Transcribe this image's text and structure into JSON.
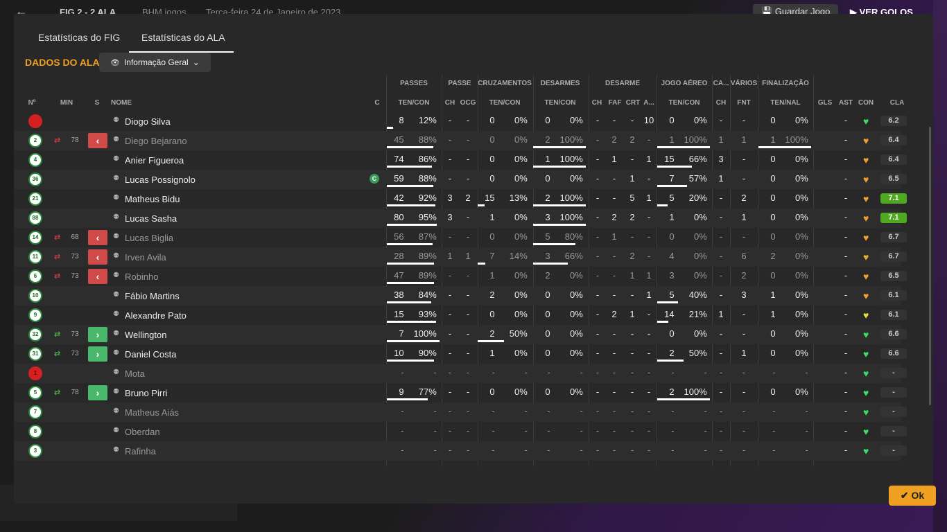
{
  "topbar": {
    "back_icon": "arrow-left-icon",
    "score": "FIG  2 - 2  ALA",
    "meta": "BHM jogos",
    "date": "Terça-feira 24 de Janeiro de 2023",
    "save_label": "Guardar Jogo",
    "goals_label": "VER GOLOS"
  },
  "tabs": [
    {
      "label": "Estatísticas do FIG",
      "active": false
    },
    {
      "label": "Estatísticas do ALA",
      "active": true
    }
  ],
  "section_title": "DADOS DO ALA",
  "dropdown": {
    "label": "Informação Geral",
    "icon": "eye-icon"
  },
  "group_headers": {
    "passes": "PASSES",
    "passe": "PASSE",
    "cruzamentos": "CRUZAMENTOS",
    "desarmes": "DESARMES",
    "desarme": "DESARME",
    "jogo_aereo": "JOGO AÉREO",
    "ca": "CA...",
    "varios": "VÁRIOS",
    "finalizacao": "FINALIZAÇÃO"
  },
  "columns": {
    "no": "Nº",
    "min": "MIN",
    "s": "S",
    "nome": "NOME",
    "c": "C",
    "passes_tc": "TEN/CON",
    "passe_ch": "CH",
    "passe_ocg": "OCG",
    "cruz_tc": "TEN/CON",
    "des_tc": "TEN/CON",
    "desarme_ch": "CH",
    "desarme_faf": "FAF",
    "desarme_crt": "CRT",
    "desarme_a": "A...",
    "aereo_tc": "TEN/CON",
    "ca_ch": "CH",
    "varios_fnt": "FNT",
    "fin_tn": "TEN/NAL",
    "gls": "GLS",
    "ast": "AST",
    "con": "CON",
    "cla": "CLA"
  },
  "rows": [
    {
      "num": "",
      "gk": true,
      "sub": "",
      "min": "",
      "name": "Diogo Silva",
      "cap": false,
      "dim": false,
      "p": [
        "8",
        "12%"
      ],
      "pc": [
        "-",
        "-"
      ],
      "cz": [
        "0",
        "0%"
      ],
      "ds": [
        "0",
        "0%"
      ],
      "de": [
        "-",
        "-",
        "-",
        "10"
      ],
      "ae": [
        "0",
        "0%"
      ],
      "ca": "-",
      "fnt": "-",
      "fn": [
        "0",
        "0%"
      ],
      "gls": "",
      "ast": "-",
      "con": "#3ddc6a",
      "cla": "6.2",
      "hi": false,
      "bars": {
        "p": 0.12,
        "cz": 0,
        "ds": 0,
        "ae": 0,
        "fn": 0
      }
    },
    {
      "num": "2",
      "gk": false,
      "sub": "out",
      "min": "78",
      "name": "Diego Bejarano",
      "cap": false,
      "dim": true,
      "p": [
        "45",
        "88%"
      ],
      "pc": [
        "-",
        "-"
      ],
      "cz": [
        "0",
        "0%"
      ],
      "ds": [
        "2",
        "100%"
      ],
      "de": [
        "-",
        "2",
        "2",
        "-"
      ],
      "ae": [
        "1",
        "100%"
      ],
      "ca": "1",
      "fnt": "1",
      "fn": [
        "1",
        "100%"
      ],
      "gls": "",
      "ast": "-",
      "con": "#f0a030",
      "cla": "6.4",
      "hi": false,
      "bars": {
        "p": 0.88,
        "cz": 0,
        "ds": 1,
        "ae": 1,
        "fn": 1
      }
    },
    {
      "num": "4",
      "gk": false,
      "sub": "",
      "min": "",
      "name": "Anier Figueroa",
      "cap": false,
      "dim": false,
      "p": [
        "74",
        "86%"
      ],
      "pc": [
        "-",
        "-"
      ],
      "cz": [
        "0",
        "0%"
      ],
      "ds": [
        "1",
        "100%"
      ],
      "de": [
        "-",
        "1",
        "-",
        "1"
      ],
      "ae": [
        "15",
        "66%"
      ],
      "ca": "3",
      "fnt": "-",
      "fn": [
        "0",
        "0%"
      ],
      "gls": "",
      "ast": "-",
      "con": "#f0a030",
      "cla": "6.4",
      "hi": false,
      "bars": {
        "p": 0.86,
        "cz": 0,
        "ds": 1,
        "ae": 0.66,
        "fn": 0
      }
    },
    {
      "num": "36",
      "gk": false,
      "sub": "",
      "min": "",
      "name": "Lucas Possignolo",
      "cap": true,
      "dim": false,
      "p": [
        "59",
        "88%"
      ],
      "pc": [
        "-",
        "-"
      ],
      "cz": [
        "0",
        "0%"
      ],
      "ds": [
        "0",
        "0%"
      ],
      "de": [
        "-",
        "-",
        "1",
        "-"
      ],
      "ae": [
        "7",
        "57%"
      ],
      "ca": "1",
      "fnt": "-",
      "fn": [
        "0",
        "0%"
      ],
      "gls": "",
      "ast": "-",
      "con": "#f0a030",
      "cla": "6.5",
      "hi": false,
      "bars": {
        "p": 0.88,
        "cz": 0,
        "ds": 0,
        "ae": 0.57,
        "fn": 0
      }
    },
    {
      "num": "21",
      "gk": false,
      "sub": "",
      "min": "",
      "name": "Matheus Bidu",
      "cap": false,
      "dim": false,
      "p": [
        "42",
        "92%"
      ],
      "pc": [
        "3",
        "2"
      ],
      "cz": [
        "15",
        "13%"
      ],
      "ds": [
        "2",
        "100%"
      ],
      "de": [
        "-",
        "-",
        "5",
        "1"
      ],
      "ae": [
        "5",
        "20%"
      ],
      "ca": "-",
      "fnt": "2",
      "fn": [
        "0",
        "0%"
      ],
      "gls": "",
      "ast": "-",
      "con": "#f0a030",
      "cla": "7.1",
      "hi": true,
      "bars": {
        "p": 0.92,
        "cz": 0.13,
        "ds": 1,
        "ae": 0.2,
        "fn": 0
      }
    },
    {
      "num": "88",
      "gk": false,
      "sub": "",
      "min": "",
      "name": "Lucas Sasha",
      "cap": false,
      "dim": false,
      "p": [
        "80",
        "95%"
      ],
      "pc": [
        "3",
        "-"
      ],
      "cz": [
        "1",
        "0%"
      ],
      "ds": [
        "3",
        "100%"
      ],
      "de": [
        "-",
        "2",
        "2",
        "-"
      ],
      "ae": [
        "1",
        "0%"
      ],
      "ca": "-",
      "fnt": "1",
      "fn": [
        "0",
        "0%"
      ],
      "gls": "",
      "ast": "-",
      "con": "#f0a030",
      "cla": "7.1",
      "hi": true,
      "bars": {
        "p": 0.95,
        "cz": 0,
        "ds": 1,
        "ae": 0,
        "fn": 0
      }
    },
    {
      "num": "14",
      "gk": false,
      "sub": "out",
      "min": "68",
      "name": "Lucas Biglia",
      "cap": false,
      "dim": true,
      "p": [
        "56",
        "87%"
      ],
      "pc": [
        "-",
        "-"
      ],
      "cz": [
        "0",
        "0%"
      ],
      "ds": [
        "5",
        "80%"
      ],
      "de": [
        "-",
        "1",
        "-",
        "-"
      ],
      "ae": [
        "0",
        "0%"
      ],
      "ca": "-",
      "fnt": "-",
      "fn": [
        "0",
        "0%"
      ],
      "gls": "",
      "ast": "-",
      "con": "#f0a030",
      "cla": "6.7",
      "hi": false,
      "bars": {
        "p": 0.87,
        "cz": 0,
        "ds": 0.8,
        "ae": 0,
        "fn": 0
      }
    },
    {
      "num": "11",
      "gk": false,
      "sub": "out",
      "min": "73",
      "name": "Irven Avila",
      "cap": false,
      "dim": true,
      "p": [
        "28",
        "89%"
      ],
      "pc": [
        "1",
        "1"
      ],
      "cz": [
        "7",
        "14%"
      ],
      "ds": [
        "3",
        "66%"
      ],
      "de": [
        "-",
        "-",
        "2",
        "-"
      ],
      "ae": [
        "4",
        "0%"
      ],
      "ca": "-",
      "fnt": "6",
      "fn": [
        "2",
        "0%"
      ],
      "gls": "",
      "ast": "-",
      "con": "#e0b030",
      "cla": "6.7",
      "hi": false,
      "bars": {
        "p": 0.89,
        "cz": 0.14,
        "ds": 0.66,
        "ae": 0,
        "fn": 0
      }
    },
    {
      "num": "6",
      "gk": false,
      "sub": "out",
      "min": "73",
      "name": "Robinho",
      "cap": false,
      "dim": true,
      "p": [
        "47",
        "89%"
      ],
      "pc": [
        "-",
        "-"
      ],
      "cz": [
        "1",
        "0%"
      ],
      "ds": [
        "2",
        "0%"
      ],
      "de": [
        "-",
        "-",
        "1",
        "1"
      ],
      "ae": [
        "3",
        "0%"
      ],
      "ca": "-",
      "fnt": "2",
      "fn": [
        "0",
        "0%"
      ],
      "gls": "",
      "ast": "-",
      "con": "#f0a030",
      "cla": "6.5",
      "hi": false,
      "bars": {
        "p": 0.89,
        "cz": 0,
        "ds": 0,
        "ae": 0,
        "fn": 0
      }
    },
    {
      "num": "10",
      "gk": false,
      "sub": "",
      "min": "",
      "name": "Fábio Martins",
      "cap": false,
      "dim": false,
      "p": [
        "38",
        "84%"
      ],
      "pc": [
        "-",
        "-"
      ],
      "cz": [
        "2",
        "0%"
      ],
      "ds": [
        "0",
        "0%"
      ],
      "de": [
        "-",
        "-",
        "-",
        "1"
      ],
      "ae": [
        "5",
        "40%"
      ],
      "ca": "-",
      "fnt": "3",
      "fn": [
        "1",
        "0%"
      ],
      "gls": "",
      "ast": "-",
      "con": "#f0a030",
      "cla": "6.1",
      "hi": false,
      "bars": {
        "p": 0.84,
        "cz": 0,
        "ds": 0,
        "ae": 0.4,
        "fn": 0
      }
    },
    {
      "num": "9",
      "gk": false,
      "sub": "",
      "min": "",
      "name": "Alexandre Pato",
      "cap": false,
      "dim": false,
      "p": [
        "15",
        "93%"
      ],
      "pc": [
        "-",
        "-"
      ],
      "cz": [
        "0",
        "0%"
      ],
      "ds": [
        "0",
        "0%"
      ],
      "de": [
        "-",
        "2",
        "1",
        "-"
      ],
      "ae": [
        "14",
        "21%"
      ],
      "ca": "1",
      "fnt": "-",
      "fn": [
        "1",
        "0%"
      ],
      "gls": "",
      "ast": "-",
      "con": "#e0e040",
      "cla": "6.1",
      "hi": false,
      "bars": {
        "p": 0.93,
        "cz": 0,
        "ds": 0,
        "ae": 0.21,
        "fn": 0
      }
    },
    {
      "num": "32",
      "gk": false,
      "sub": "in",
      "min": "73",
      "name": "Wellington",
      "cap": false,
      "dim": false,
      "p": [
        "7",
        "100%"
      ],
      "pc": [
        "-",
        "-"
      ],
      "cz": [
        "2",
        "50%"
      ],
      "ds": [
        "0",
        "0%"
      ],
      "de": [
        "-",
        "-",
        "-",
        "-"
      ],
      "ae": [
        "0",
        "0%"
      ],
      "ca": "-",
      "fnt": "-",
      "fn": [
        "0",
        "0%"
      ],
      "gls": "",
      "ast": "-",
      "con": "#3ddc6a",
      "cla": "6.6",
      "hi": false,
      "bars": {
        "p": 1,
        "cz": 0.5,
        "ds": 0,
        "ae": 0,
        "fn": 0
      }
    },
    {
      "num": "31",
      "gk": false,
      "sub": "in",
      "min": "73",
      "name": "Daniel Costa",
      "cap": false,
      "dim": false,
      "p": [
        "10",
        "90%"
      ],
      "pc": [
        "-",
        "-"
      ],
      "cz": [
        "1",
        "0%"
      ],
      "ds": [
        "0",
        "0%"
      ],
      "de": [
        "-",
        "-",
        "-",
        "-"
      ],
      "ae": [
        "2",
        "50%"
      ],
      "ca": "-",
      "fnt": "1",
      "fn": [
        "0",
        "0%"
      ],
      "gls": "",
      "ast": "-",
      "con": "#3ddc6a",
      "cla": "6.6",
      "hi": false,
      "bars": {
        "p": 0.9,
        "cz": 0,
        "ds": 0,
        "ae": 0.5,
        "fn": 0
      }
    },
    {
      "num": "1",
      "gk": true,
      "sub": "",
      "min": "",
      "name": "Mota",
      "cap": false,
      "dim": true,
      "p": [
        "-",
        "-"
      ],
      "pc": [
        "-",
        "-"
      ],
      "cz": [
        "-",
        "-"
      ],
      "ds": [
        "-",
        "-"
      ],
      "de": [
        "-",
        "-",
        "-",
        "-"
      ],
      "ae": [
        "-",
        "-"
      ],
      "ca": "-",
      "fnt": "-",
      "fn": [
        "-",
        "-"
      ],
      "gls": "",
      "ast": "-",
      "con": "#3ddc6a",
      "cla": "-",
      "hi": false,
      "bars": {
        "p": 0,
        "cz": 0,
        "ds": 0,
        "ae": 0,
        "fn": 0
      }
    },
    {
      "num": "5",
      "gk": false,
      "sub": "in",
      "min": "78",
      "name": "Bruno Pirri",
      "cap": false,
      "dim": false,
      "p": [
        "9",
        "77%"
      ],
      "pc": [
        "-",
        "-"
      ],
      "cz": [
        "0",
        "0%"
      ],
      "ds": [
        "0",
        "0%"
      ],
      "de": [
        "-",
        "-",
        "-",
        "-"
      ],
      "ae": [
        "2",
        "100%"
      ],
      "ca": "-",
      "fnt": "-",
      "fn": [
        "0",
        "0%"
      ],
      "gls": "",
      "ast": "-",
      "con": "#3ddc6a",
      "cla": "-",
      "hi": false,
      "bars": {
        "p": 0.77,
        "cz": 0,
        "ds": 0,
        "ae": 1,
        "fn": 0
      }
    },
    {
      "num": "7",
      "gk": false,
      "sub": "",
      "min": "",
      "name": "Matheus Aiás",
      "cap": false,
      "dim": true,
      "p": [
        "-",
        "-"
      ],
      "pc": [
        "-",
        "-"
      ],
      "cz": [
        "-",
        "-"
      ],
      "ds": [
        "-",
        "-"
      ],
      "de": [
        "-",
        "-",
        "-",
        "-"
      ],
      "ae": [
        "-",
        "-"
      ],
      "ca": "-",
      "fnt": "-",
      "fn": [
        "-",
        "-"
      ],
      "gls": "",
      "ast": "-",
      "con": "#3ddc6a",
      "cla": "-",
      "hi": false,
      "bars": {
        "p": 0,
        "cz": 0,
        "ds": 0,
        "ae": 0,
        "fn": 0
      }
    },
    {
      "num": "8",
      "gk": false,
      "sub": "",
      "min": "",
      "name": "Oberdan",
      "cap": false,
      "dim": true,
      "p": [
        "-",
        "-"
      ],
      "pc": [
        "-",
        "-"
      ],
      "cz": [
        "-",
        "-"
      ],
      "ds": [
        "-",
        "-"
      ],
      "de": [
        "-",
        "-",
        "-",
        "-"
      ],
      "ae": [
        "-",
        "-"
      ],
      "ca": "-",
      "fnt": "-",
      "fn": [
        "-",
        "-"
      ],
      "gls": "",
      "ast": "-",
      "con": "#3ddc6a",
      "cla": "-",
      "hi": false,
      "bars": {
        "p": 0,
        "cz": 0,
        "ds": 0,
        "ae": 0,
        "fn": 0
      }
    },
    {
      "num": "3",
      "gk": false,
      "sub": "",
      "min": "",
      "name": "Rafinha",
      "cap": false,
      "dim": true,
      "p": [
        "-",
        "-"
      ],
      "pc": [
        "-",
        "-"
      ],
      "cz": [
        "-",
        "-"
      ],
      "ds": [
        "-",
        "-"
      ],
      "de": [
        "-",
        "-",
        "-",
        "-"
      ],
      "ae": [
        "-",
        "-"
      ],
      "ca": "-",
      "fnt": "-",
      "fn": [
        "-",
        "-"
      ],
      "gls": "",
      "ast": "-",
      "con": "#3ddc6a",
      "cla": "-",
      "hi": false,
      "bars": {
        "p": 0,
        "cz": 0,
        "ds": 0,
        "ae": 0,
        "fn": 0
      }
    }
  ],
  "ok_label": "Ok",
  "cap_letter": "C",
  "accent": "#f0a020"
}
